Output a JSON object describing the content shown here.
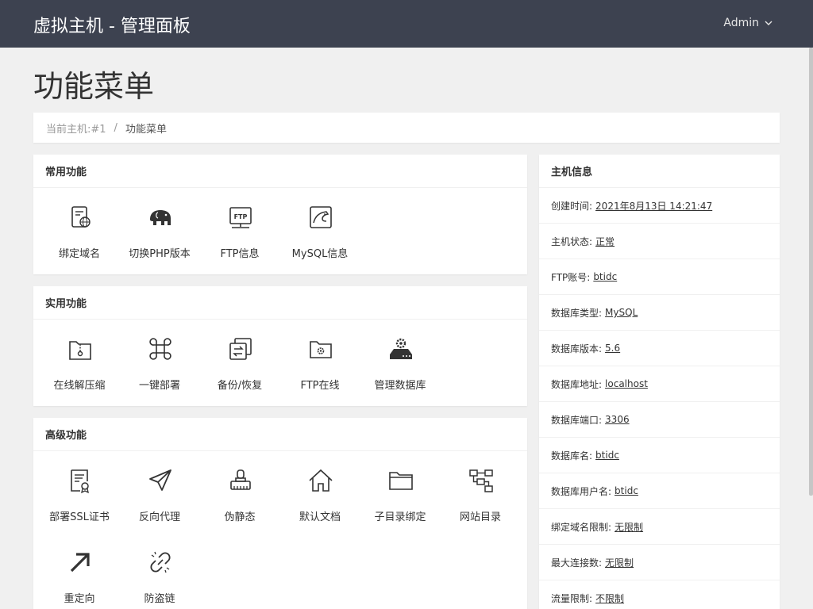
{
  "header": {
    "title": "虚拟主机 - 管理面板",
    "user": "Admin"
  },
  "page": {
    "title": "功能菜单"
  },
  "breadcrumb": {
    "host": "当前主机:#1",
    "separator": "/",
    "current": "功能菜单"
  },
  "sections": [
    {
      "title": "常用功能",
      "items": [
        {
          "label": "绑定域名",
          "icon": "domain-icon"
        },
        {
          "label": "切换PHP版本",
          "icon": "php-elephant-icon"
        },
        {
          "label": "FTP信息",
          "icon": "ftp-icon"
        },
        {
          "label": "MySQL信息",
          "icon": "mysql-icon"
        }
      ]
    },
    {
      "title": "实用功能",
      "items": [
        {
          "label": "在线解压缩",
          "icon": "zip-icon"
        },
        {
          "label": "一键部署",
          "icon": "command-icon"
        },
        {
          "label": "备份/恢复",
          "icon": "backup-icon"
        },
        {
          "label": "FTP在线",
          "icon": "folder-gear-icon"
        },
        {
          "label": "管理数据库",
          "icon": "database-gear-icon"
        }
      ]
    },
    {
      "title": "高级功能",
      "items": [
        {
          "label": "部署SSL证书",
          "icon": "certificate-icon"
        },
        {
          "label": "反向代理",
          "icon": "paper-plane-icon"
        },
        {
          "label": "伪静态",
          "icon": "stamp-icon"
        },
        {
          "label": "默认文档",
          "icon": "home-icon"
        },
        {
          "label": "子目录绑定",
          "icon": "folder-icon"
        },
        {
          "label": "网站目录",
          "icon": "sitemap-icon"
        },
        {
          "label": "重定向",
          "icon": "redirect-arrow-icon"
        },
        {
          "label": "防盗链",
          "icon": "broken-link-icon"
        }
      ]
    }
  ],
  "host_info": {
    "title": "主机信息",
    "rows": [
      {
        "key": "创建时间:",
        "value": "2021年8月13日 14:21:47"
      },
      {
        "key": "主机状态:",
        "value": "正常"
      },
      {
        "key": "FTP账号:",
        "value": "btidc"
      },
      {
        "key": "数据库类型:",
        "value": "MySQL"
      },
      {
        "key": "数据库版本:",
        "value": "5.6"
      },
      {
        "key": "数据库地址:",
        "value": "localhost"
      },
      {
        "key": "数据库端口:",
        "value": "3306"
      },
      {
        "key": "数据库名:",
        "value": "btidc"
      },
      {
        "key": "数据库用户名:",
        "value": "btidc"
      },
      {
        "key": "绑定域名限制:",
        "value": "无限制"
      },
      {
        "key": "最大连接数:",
        "value": "无限制"
      },
      {
        "key": "流量限制:",
        "value": "不限制"
      }
    ]
  },
  "colors": {
    "topbar": "#3d4250",
    "background": "#f0f0f0",
    "card": "#ffffff",
    "icon": "#333333"
  }
}
